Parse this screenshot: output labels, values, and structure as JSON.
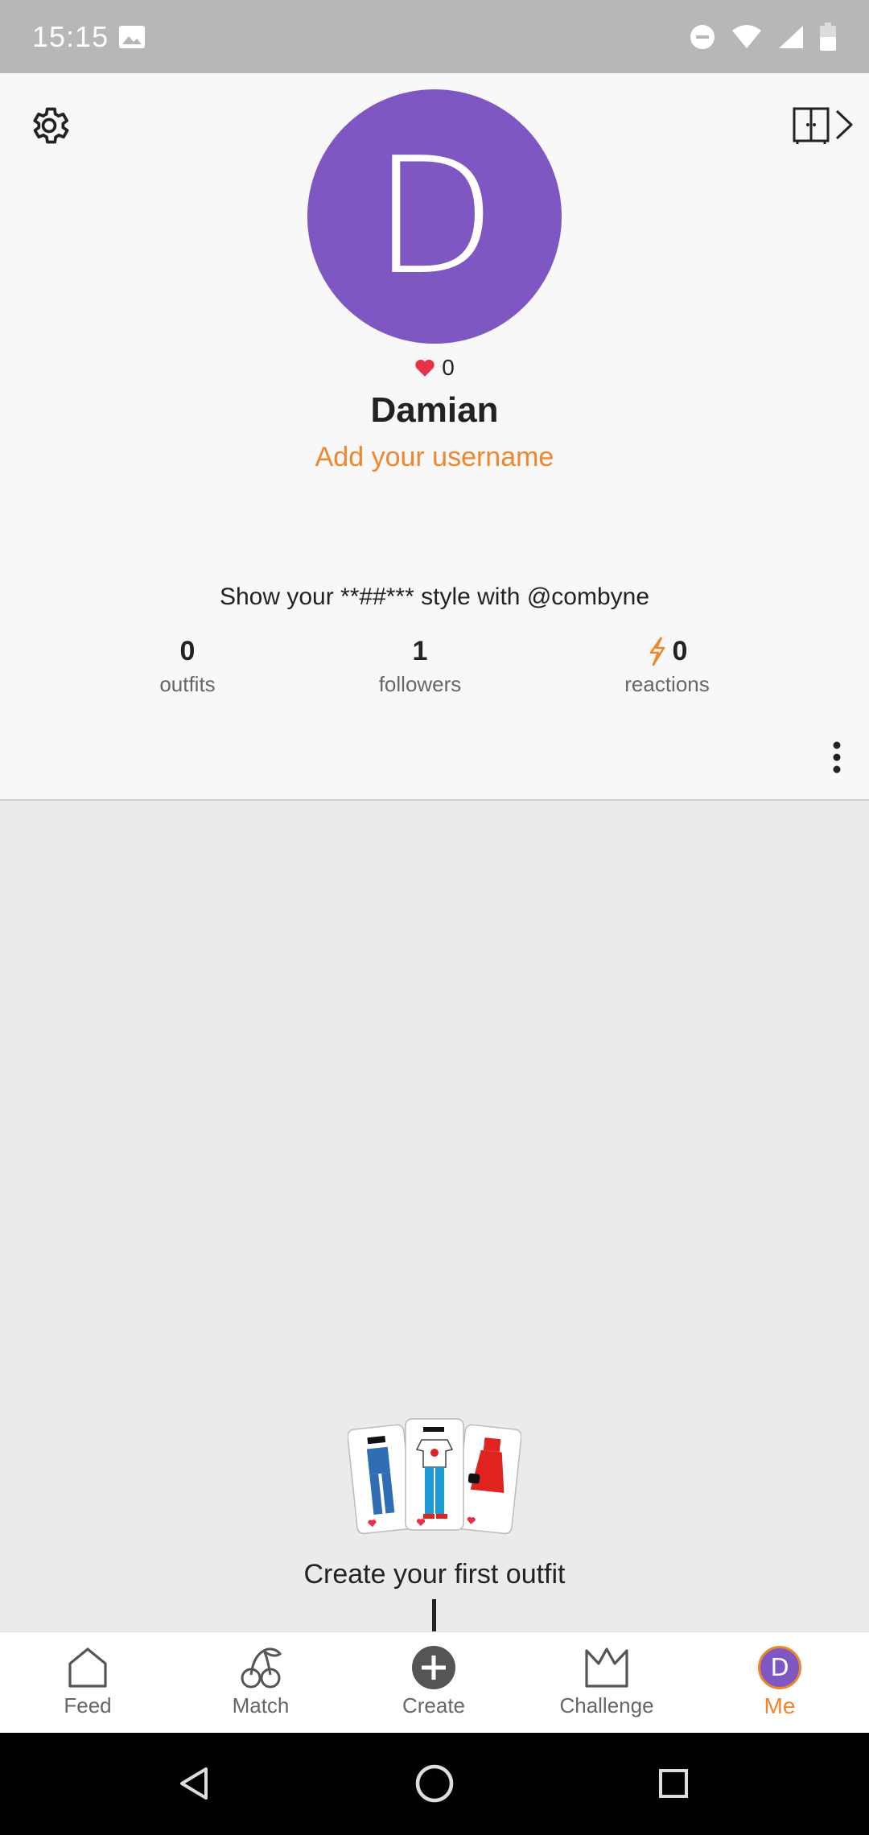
{
  "status_bar": {
    "time": "15:15"
  },
  "profile": {
    "avatar_initial": "D",
    "likes_count": "0",
    "display_name": "Damian",
    "add_username_label": "Add your username",
    "bio": "Show your **##*** style with @combyne",
    "stats": [
      {
        "value": "0",
        "label": "outfits"
      },
      {
        "value": "1",
        "label": "followers"
      },
      {
        "value": "0",
        "label": "reactions"
      }
    ]
  },
  "empty_state": {
    "message": "Create your first outfit"
  },
  "bottom_nav": {
    "items": [
      {
        "label": "Feed",
        "icon": "home-icon"
      },
      {
        "label": "Match",
        "icon": "cherries-icon"
      },
      {
        "label": "Create",
        "icon": "plus-circle-icon"
      },
      {
        "label": "Challenge",
        "icon": "crown-icon"
      },
      {
        "label": "Me",
        "icon": "avatar",
        "avatar_initial": "D",
        "active": true
      }
    ]
  },
  "colors": {
    "accent": "#f0862b",
    "avatar": "#7e57c2",
    "heart": "#e8304a",
    "status_bar": "#b7b7b7"
  }
}
